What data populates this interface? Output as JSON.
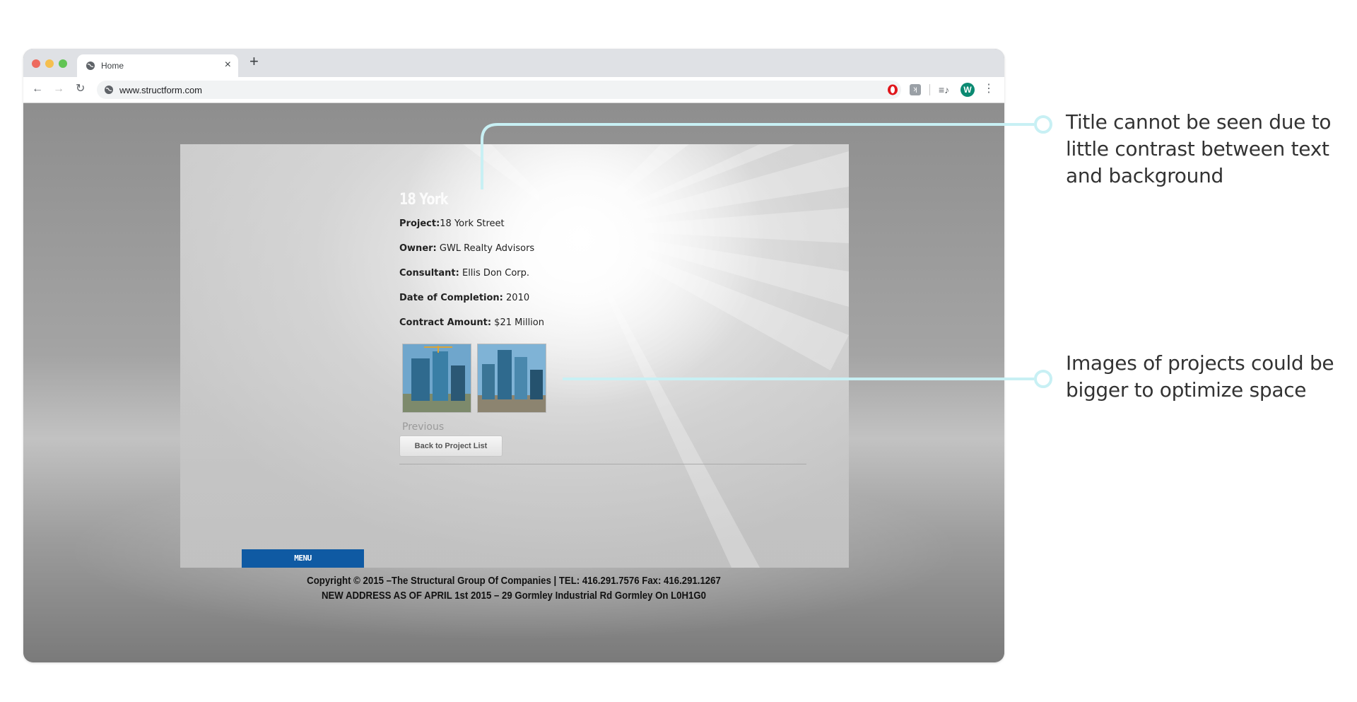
{
  "browser": {
    "tab_title": "Home",
    "tab_close": "×",
    "new_tab": "+",
    "url": "www.structform.com",
    "avatar_letter": "W",
    "menu_glyph": "⋮",
    "nav": {
      "back": "←",
      "forward": "→",
      "reload": "↻"
    }
  },
  "page": {
    "title": "18 York",
    "details": [
      {
        "label": "Project:",
        "value": "18 York Street"
      },
      {
        "label": "Owner:",
        "value": " GWL Realty Advisors"
      },
      {
        "label": "Consultant:",
        "value": " Ellis Don Corp."
      },
      {
        "label": "Date of Completion:",
        "value": " 2010"
      },
      {
        "label": "Contract Amount:",
        "value": " $21 Million"
      }
    ],
    "previous_label": "Previous",
    "back_button": "Back to Project List",
    "menu_label": "MENU",
    "footer": [
      "Copyright © 2015 –The Structural Group Of Companies |  TEL: 416.291.7576 Fax: 416.291.1267",
      "NEW ADDRESS AS OF APRIL 1st 2015 – 29 Gormley Industrial Rd Gormley On L0H1G0"
    ]
  },
  "annotations": [
    "Title cannot be seen due to little contrast between text and background",
    "Images of projects could be bigger to optimize space"
  ],
  "colors": {
    "callout_line": "#c8f0f4",
    "menu_bar": "#0f5aa3",
    "avatar": "#0b8a72"
  }
}
